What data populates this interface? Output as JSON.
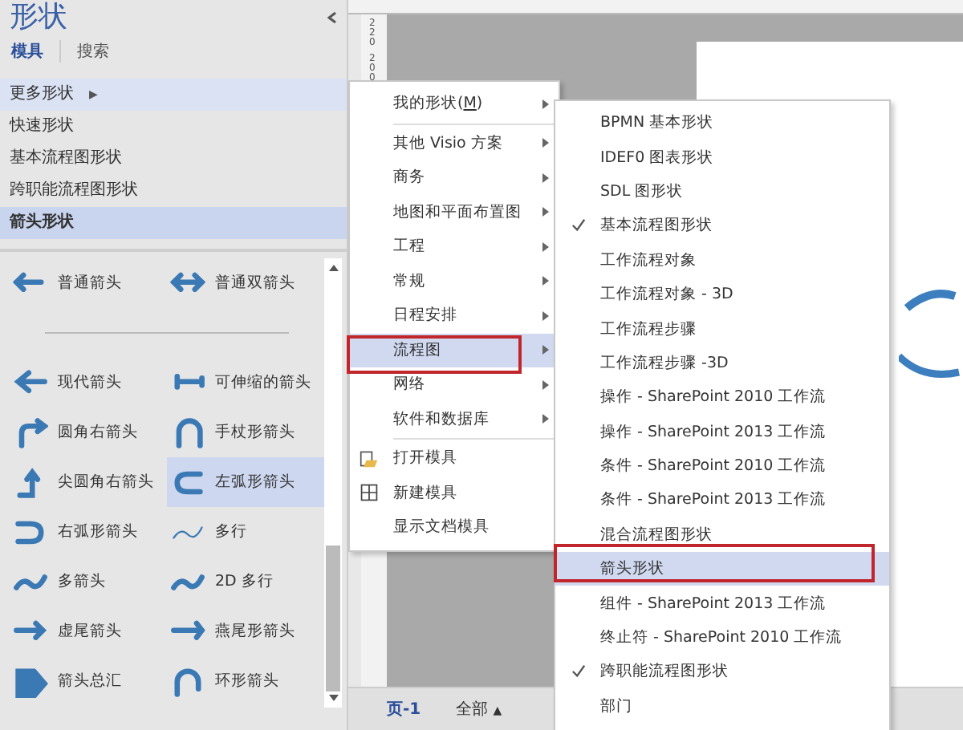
{
  "panel": {
    "title": "形状",
    "tabs": [
      {
        "label": "模具",
        "selected": true
      },
      {
        "label": "搜索",
        "selected": false
      }
    ],
    "stencils": [
      {
        "label": "更多形状",
        "arrow": "▶",
        "selected": false,
        "hover": true
      },
      {
        "label": "快速形状",
        "selected": false,
        "hover": false
      },
      {
        "label": "基本流程图形状",
        "selected": false,
        "hover": false
      },
      {
        "label": "跨职能流程图形状",
        "selected": false,
        "hover": false
      },
      {
        "label": "箭头形状",
        "selected": true,
        "hover": false
      }
    ],
    "shapes": [
      {
        "label": "普通箭头",
        "selected": false
      },
      {
        "label": "普通双箭头",
        "selected": false
      },
      {
        "label": "现代箭头",
        "selected": false
      },
      {
        "label": "可伸缩的箭头",
        "selected": false
      },
      {
        "label": "圆角右箭头",
        "selected": false
      },
      {
        "label": "手杖形箭头",
        "selected": false
      },
      {
        "label": "尖圆角右箭头",
        "selected": false
      },
      {
        "label": "左弧形箭头",
        "selected": true
      },
      {
        "label": "右弧形箭头",
        "selected": false
      },
      {
        "label": "多行",
        "selected": false
      },
      {
        "label": "多箭头",
        "selected": false
      },
      {
        "label": "2D 多行",
        "selected": false
      },
      {
        "label": "虚尾箭头",
        "selected": false
      },
      {
        "label": "燕尾形箭头",
        "selected": false
      },
      {
        "label": "箭头总汇",
        "selected": false
      },
      {
        "label": "环形箭头",
        "selected": false
      }
    ]
  },
  "ruler": {
    "labels": [
      "220",
      "200"
    ]
  },
  "status_bar": {
    "page_tab": "页-1",
    "all_button": "全部",
    "all_caret": "▲"
  },
  "menu": {
    "items": [
      {
        "label": "我的形状(",
        "mnemonic": "M",
        "suffix": ")",
        "submenu": true,
        "selected": false,
        "kind": "text"
      },
      {
        "label": "其他 Visio 方案",
        "submenu": true,
        "selected": false,
        "kind": "text"
      },
      {
        "label": "商务",
        "submenu": true,
        "selected": false,
        "kind": "text"
      },
      {
        "label": "地图和平面布置图",
        "submenu": true,
        "selected": false,
        "kind": "text"
      },
      {
        "label": "工程",
        "submenu": true,
        "selected": false,
        "kind": "text"
      },
      {
        "label": "常规",
        "submenu": true,
        "selected": false,
        "kind": "text"
      },
      {
        "label": "日程安排",
        "submenu": true,
        "selected": false,
        "kind": "text"
      },
      {
        "label": "流程图",
        "submenu": true,
        "selected": true,
        "kind": "text"
      },
      {
        "label": "网络",
        "submenu": true,
        "selected": false,
        "kind": "text"
      },
      {
        "label": "软件和数据库",
        "submenu": true,
        "selected": false,
        "kind": "text"
      },
      {
        "label": "打开模具",
        "submenu": false,
        "selected": false,
        "kind": "open"
      },
      {
        "label": "新建模具",
        "submenu": false,
        "selected": false,
        "kind": "new"
      },
      {
        "label": "显示文档模具",
        "submenu": false,
        "selected": false,
        "kind": "text"
      }
    ]
  },
  "submenu": {
    "items": [
      {
        "label": "BPMN 基本形状",
        "checked": false,
        "selected": false
      },
      {
        "label": "IDEF0 图表形状",
        "checked": false,
        "selected": false
      },
      {
        "label": "SDL 图形状",
        "checked": false,
        "selected": false
      },
      {
        "label": "基本流程图形状",
        "checked": true,
        "selected": false
      },
      {
        "label": "工作流程对象",
        "checked": false,
        "selected": false
      },
      {
        "label": "工作流程对象 - 3D",
        "checked": false,
        "selected": false
      },
      {
        "label": "工作流程步骤",
        "checked": false,
        "selected": false
      },
      {
        "label": "工作流程步骤 -3D",
        "checked": false,
        "selected": false
      },
      {
        "label": "操作 - SharePoint 2010 工作流",
        "checked": false,
        "selected": false
      },
      {
        "label": "操作 - SharePoint 2013 工作流",
        "checked": false,
        "selected": false
      },
      {
        "label": "条件 - SharePoint 2010 工作流",
        "checked": false,
        "selected": false
      },
      {
        "label": "条件 - SharePoint 2013 工作流",
        "checked": false,
        "selected": false
      },
      {
        "label": "混合流程图形状",
        "checked": false,
        "selected": false
      },
      {
        "label": "箭头形状",
        "checked": false,
        "selected": true
      },
      {
        "label": "组件 - SharePoint 2013 工作流",
        "checked": false,
        "selected": false
      },
      {
        "label": "终止符 - SharePoint 2010 工作流",
        "checked": false,
        "selected": false
      },
      {
        "label": "跨职能流程图形状",
        "checked": true,
        "selected": false
      },
      {
        "label": "部门",
        "checked": false,
        "selected": false
      }
    ]
  }
}
